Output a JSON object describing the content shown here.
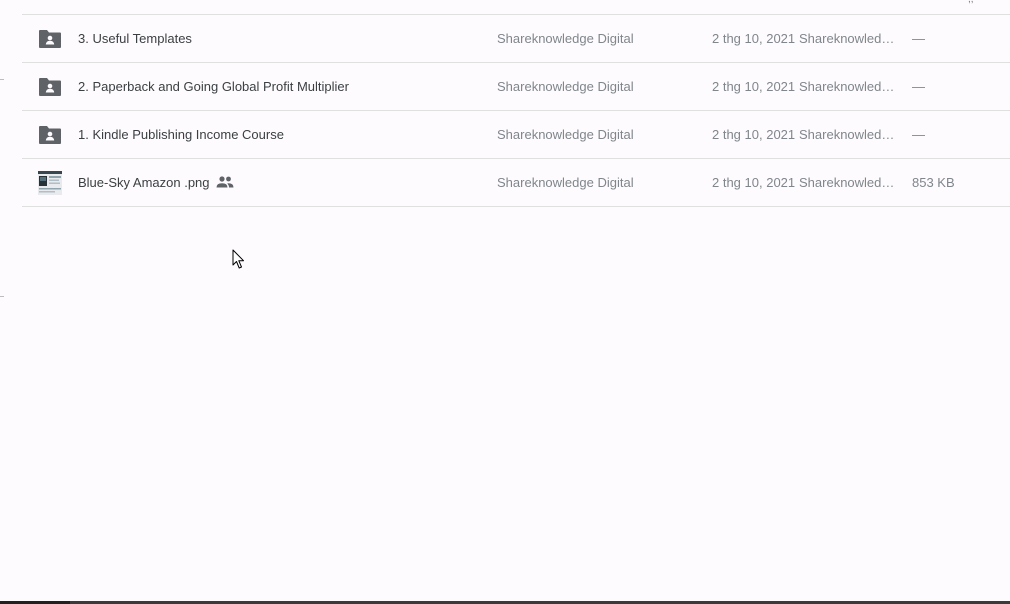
{
  "files": [
    {
      "type": "shared-folder",
      "name": "3. Useful Templates",
      "owner": "Shareknowledge Digital",
      "modified_date": "2 thg 10, 2021",
      "modified_by": "Shareknowledg…",
      "size": "—"
    },
    {
      "type": "shared-folder",
      "name": "2. Paperback and Going Global Profit Multiplier",
      "owner": "Shareknowledge Digital",
      "modified_date": "2 thg 10, 2021",
      "modified_by": "Shareknowledg…",
      "size": "—"
    },
    {
      "type": "shared-folder",
      "name": "1. Kindle Publishing Income Course",
      "owner": "Shareknowledge Digital",
      "modified_date": "2 thg 10, 2021",
      "modified_by": "Shareknowledg…",
      "size": "—"
    },
    {
      "type": "image",
      "name": "Blue-Sky Amazon .png",
      "shared": true,
      "owner": "Shareknowledge Digital",
      "modified_date": "2 thg 10, 2021",
      "modified_by": "Shareknowledg…",
      "size": "853 KB"
    }
  ],
  "icons": {
    "folder": "shared-folder-icon",
    "image_thumbnail": "image-thumbnail-icon",
    "shared": "people-icon",
    "cursor": "mouse-pointer-icon"
  },
  "colors": {
    "background": "#fdfbfe",
    "text_primary": "#3c4043",
    "text_secondary": "#80868b",
    "icon": "#5f6368",
    "divider": "#e0e0e0"
  }
}
